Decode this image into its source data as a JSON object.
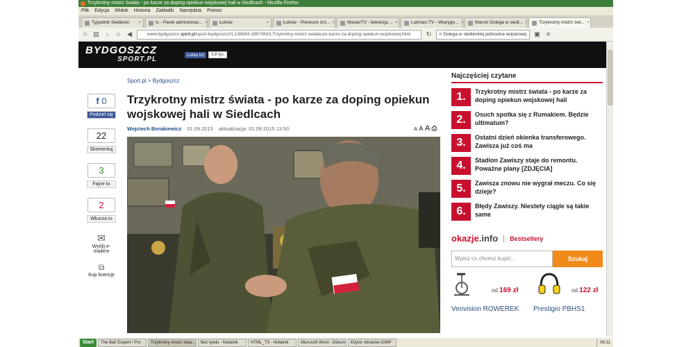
{
  "window": {
    "title": "Trzykrotny mistrz świata - po karze za doping opiekun wojskowej hali w Siedlcach - Mozilla Firefox"
  },
  "menu": [
    "Plik",
    "Edycja",
    "Widok",
    "Historia",
    "Zakładki",
    "Narzędzia",
    "Pomoc"
  ],
  "tabs": [
    {
      "label": "Tygodnik Siedlecki"
    },
    {
      "label": "ts - Panel administrac..."
    },
    {
      "label": "Łuków"
    },
    {
      "label": "Łuków - Pierwsze źró..."
    },
    {
      "label": "MasterTV - telewizja ..."
    },
    {
      "label": "Lukman.TV - Wiarygo..."
    },
    {
      "label": "Marcin Dolega w siedl..."
    },
    {
      "label": "Trzykrotny mistrz świ..."
    }
  ],
  "url": {
    "host": "www.bydgoszcz.",
    "domain": "sport.pl",
    "path": "/sport-bydgoszcz/1,138843,18674543,Trzykrotny-mistrz-swiata-po-karze-za-doping-opiekun-wojskowej.html"
  },
  "search": {
    "value": "n Dolega w siedleckiej jednostce wojskowej"
  },
  "site": {
    "logo_top": "BYDGOSZCZ",
    "logo_bottom": "SPORT.PL",
    "fb_like": "Lubię to!",
    "fb_count": "3,8 tys."
  },
  "article": {
    "crumb1": "Sport.pl",
    "crumb2": "Bydgoszcz",
    "title": "Trzykrotny mistrz świata - po karze za doping opiekun wojskowej hali w Siedlcach",
    "author": "Wojciech Borakiewicz",
    "date": "01.09.2015",
    "updated": "aktualizacja: 01.09.2015 13:50"
  },
  "share": {
    "fb_count": "0",
    "fb_label": "Podziel się",
    "comments": "22",
    "comments_label": "Skomentuj",
    "likes": "3",
    "likes_label": "Fajne to",
    "dislikes": "2",
    "dislikes_label": "Wkurza to",
    "email_label": "Wyślij e-mailem",
    "license_label": "Kup licencję"
  },
  "sidebar": {
    "title": "Najczęściej czytane",
    "items": [
      {
        "n": "1.",
        "text": "Trzykrotny mistrz świata - po karze za doping opiekun wojskowej hali"
      },
      {
        "n": "2.",
        "text": "Osuch spotka się z Rumakiem. Będzie ultimatum?"
      },
      {
        "n": "3.",
        "text": "Ostatni dzień okienka transferowego. Zawisza już coś ma"
      },
      {
        "n": "4.",
        "text": "Stadion Zawiszy staje do remontu. Poważne plany [ZDJĘCIA]"
      },
      {
        "n": "5.",
        "text": "Zawisza znowu nie wygrał meczu. Co się dzieje?"
      },
      {
        "n": "6.",
        "text": "Błędy Zawiszy. Niestety ciągle są takie same"
      }
    ]
  },
  "okazje": {
    "brand": "okazje",
    "brand_suffix": ".info",
    "section": "Bestsellery",
    "placeholder": "Wpisz co chcesz kupić...",
    "button": "Szukaj",
    "products": [
      {
        "price_prefix": "od",
        "price": "169 zł",
        "name": "Veovision ROWEREK"
      },
      {
        "price_prefix": "od",
        "price": "122 zł",
        "name": "Prestigio PBHS1"
      }
    ]
  },
  "taskbar": {
    "start": "Start",
    "items": [
      "The Bat! Elupert / Pro",
      "Trzykrotny mistrz świa...",
      "Bez tytułu - Notatnik",
      "HTML_TS - Notatnik",
      "Microsoft Word - Dokum...",
      "Edytor obrazów GIMP"
    ],
    "clock": "08:31"
  }
}
